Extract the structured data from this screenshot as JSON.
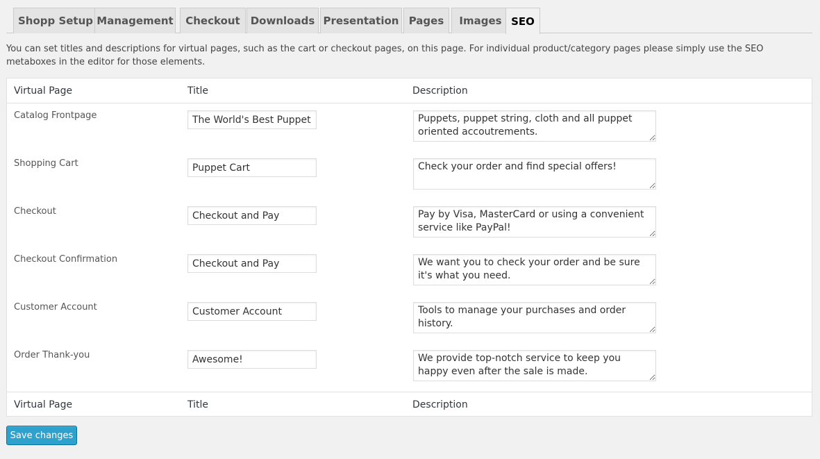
{
  "tabs": [
    {
      "label": "Shopp Setup"
    },
    {
      "label": "Management"
    },
    {
      "label": "Checkout"
    },
    {
      "label": "Downloads"
    },
    {
      "label": "Presentation"
    },
    {
      "label": "Pages"
    },
    {
      "label": "Images"
    },
    {
      "label": "SEO",
      "active": true
    }
  ],
  "intro": "You can set titles and descriptions for virtual pages, such as the cart or checkout pages, on this page. For individual product/category pages please simply use the SEO metaboxes in the editor for those elements.",
  "table": {
    "headers": {
      "page": "Virtual Page",
      "title": "Title",
      "description": "Description"
    },
    "rows": [
      {
        "page": "Catalog Frontpage",
        "title": "The World's Best Puppet Shop",
        "description": "Puppets, puppet string, cloth and all puppet oriented accoutrements."
      },
      {
        "page": "Shopping Cart",
        "title": "Puppet Cart",
        "description": "Check your order and find special offers!"
      },
      {
        "page": "Checkout",
        "title": "Checkout and Pay",
        "description": "Pay by Visa, MasterCard or using a convenient service like PayPal!"
      },
      {
        "page": "Checkout Confirmation",
        "title": "Checkout and Pay",
        "description": "We want you to check your order and be sure it's what you need."
      },
      {
        "page": "Customer Account",
        "title": "Customer Account",
        "description": "Tools to manage your purchases and order history."
      },
      {
        "page": "Order Thank-you",
        "title": "Awesome!",
        "description": "We provide top-notch service to keep you happy even after the sale is made."
      }
    ]
  },
  "save_label": "Save changes"
}
